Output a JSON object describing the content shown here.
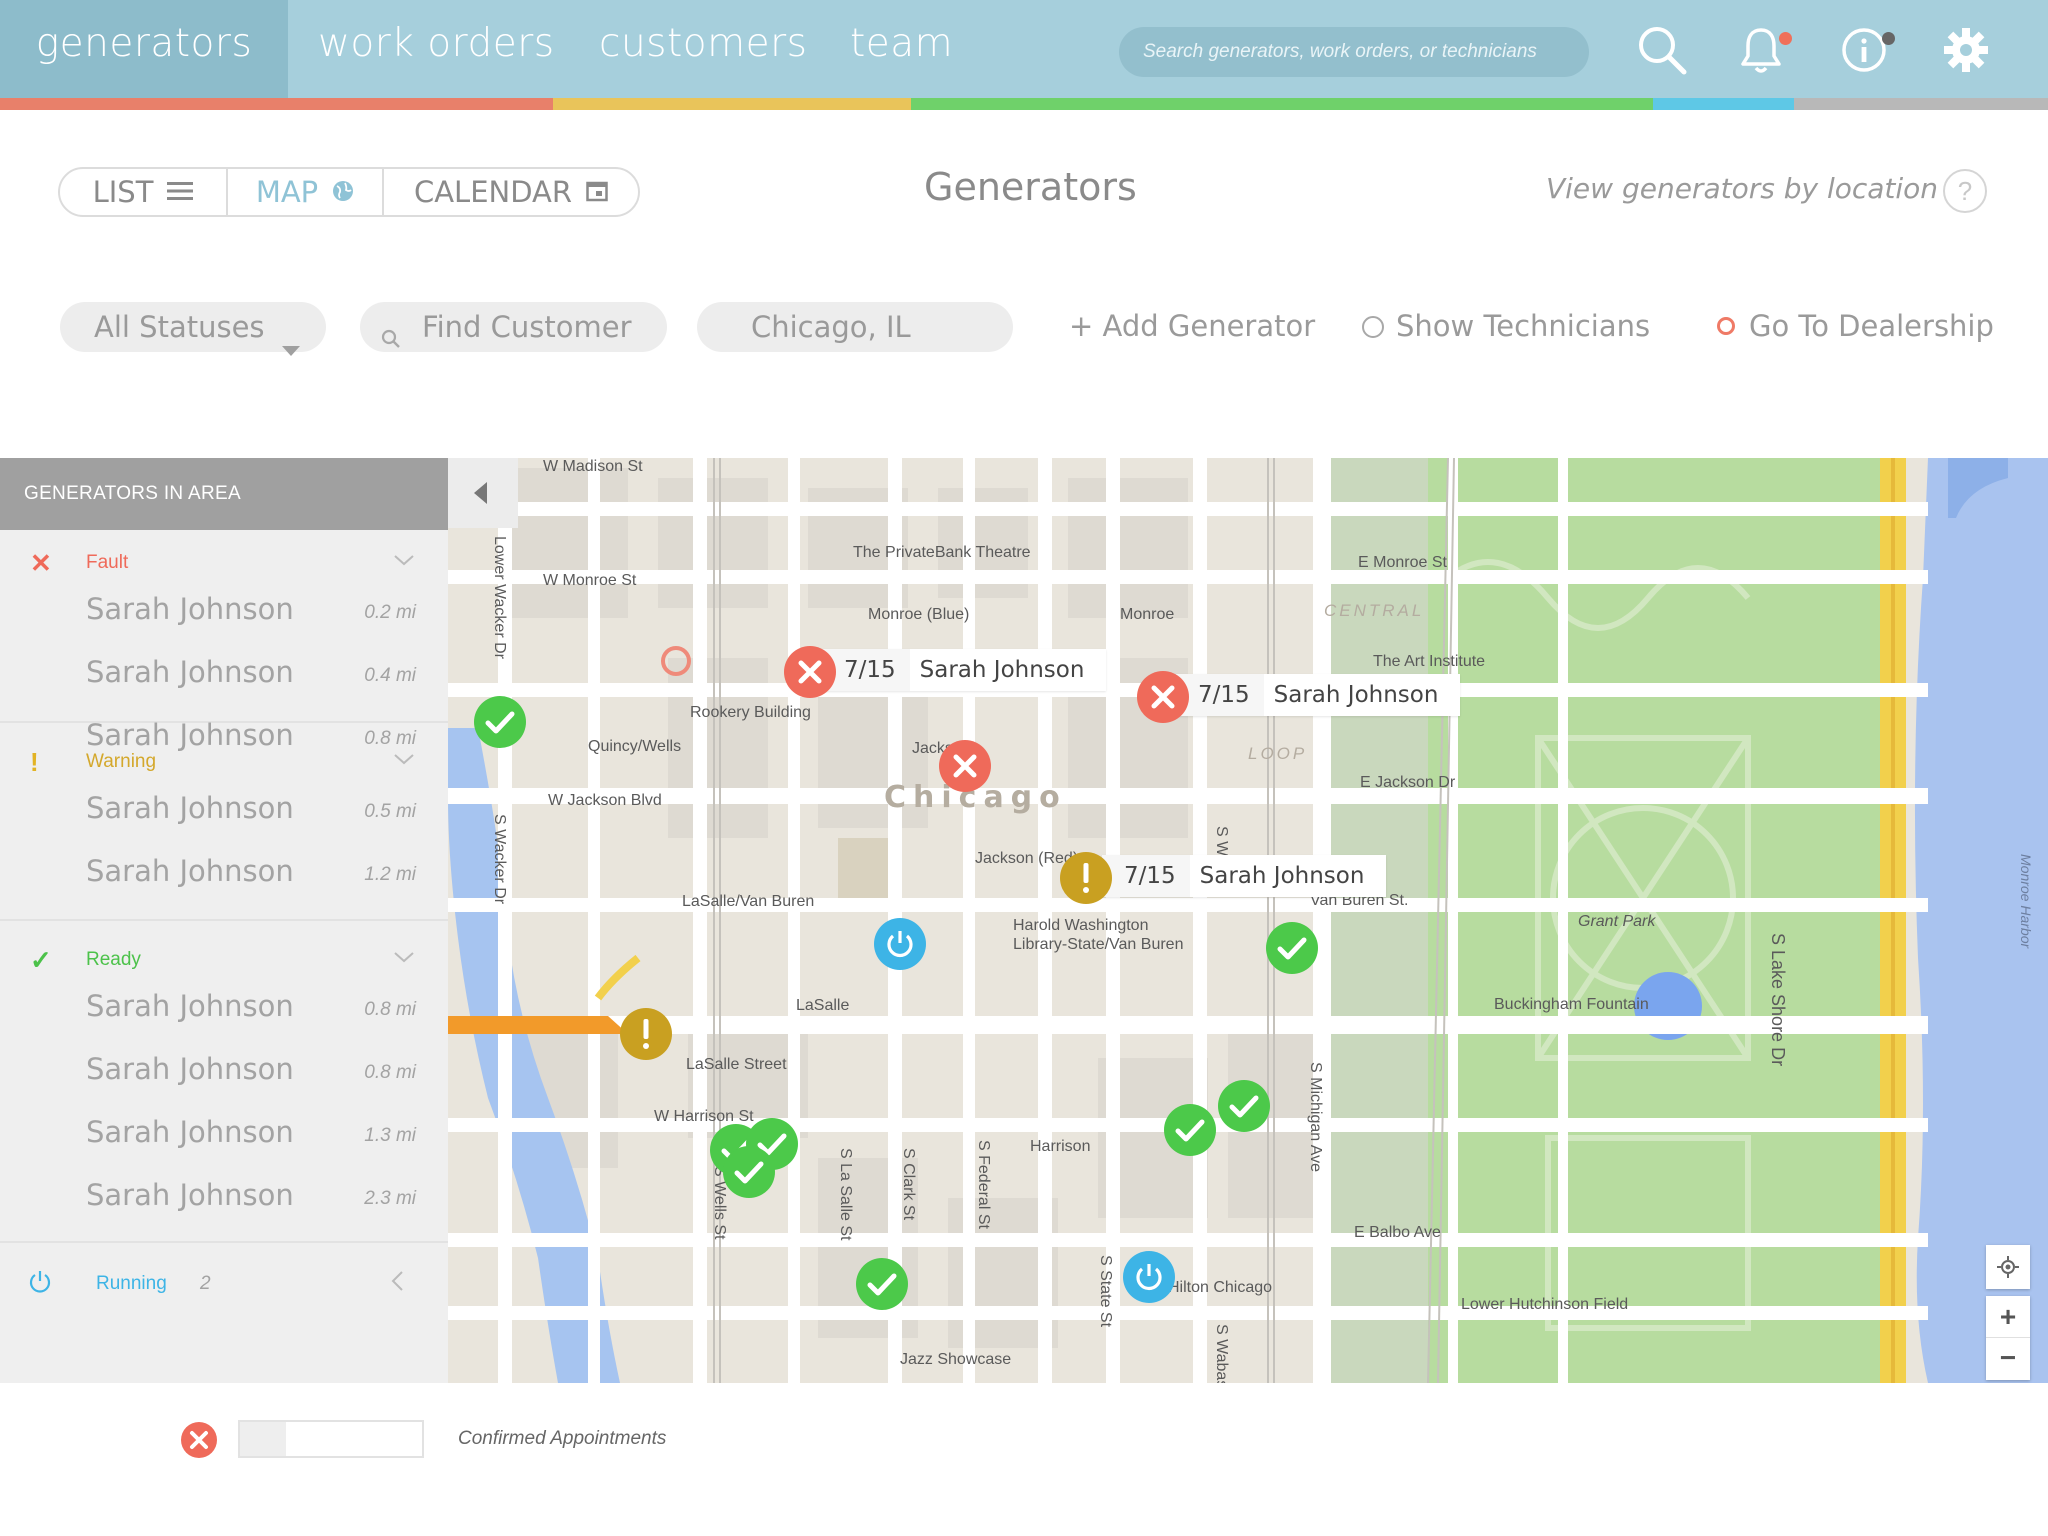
{
  "nav": {
    "tabs": [
      {
        "label": "generators",
        "active": true
      },
      {
        "label": "work orders"
      },
      {
        "label": "customers"
      },
      {
        "label": "team"
      }
    ],
    "search_placeholder": "Search generators, work orders, or technicians",
    "icons": [
      "search-icon",
      "bell-icon",
      "info-icon",
      "gear-icon"
    ],
    "notification_dot_color": "#f0705a",
    "info_dot_color": "#666666",
    "colorbar": [
      "#e8806a",
      "#e9c45a",
      "#6fd16a",
      "#5ec8e6",
      "#b8b8b8"
    ]
  },
  "view_switch": {
    "list_label": "LIST",
    "map_label": "MAP",
    "calendar_label": "CALENDAR",
    "active": "MAP"
  },
  "header": {
    "title": "Generators",
    "subtitle": "View generators by location",
    "help": "?"
  },
  "filters": {
    "status": "All Statuses",
    "customer_placeholder": "Find Customer",
    "location": "Chicago, IL",
    "add_generator": "+ Add Generator",
    "show_technicians": "Show Technicians",
    "go_to_dealership": "Go To Dealership"
  },
  "sidebar": {
    "header": "GENERATORS IN AREA",
    "groups": [
      {
        "label": "Fault",
        "icon": "x-icon",
        "color": "#ef6a5a",
        "items": [
          {
            "name": "Sarah Johnson",
            "distance": "0.2 mi"
          },
          {
            "name": "Sarah Johnson",
            "distance": "0.4 mi"
          },
          {
            "name": "Sarah Johnson",
            "distance": "0.8 mi"
          }
        ]
      },
      {
        "label": "Warning",
        "icon": "exclamation-icon",
        "color": "#d4a82c",
        "items": [
          {
            "name": "Sarah Johnson",
            "distance": "0.5 mi"
          },
          {
            "name": "Sarah Johnson",
            "distance": "1.2 mi"
          }
        ]
      },
      {
        "label": "Ready",
        "icon": "check-icon",
        "color": "#4cc24a",
        "items": [
          {
            "name": "Sarah Johnson",
            "distance": "0.8 mi"
          },
          {
            "name": "Sarah Johnson",
            "distance": "0.8 mi"
          },
          {
            "name": "Sarah Johnson",
            "distance": "1.3 mi"
          },
          {
            "name": "Sarah Johnson",
            "distance": "2.3 mi"
          }
        ]
      }
    ],
    "running": {
      "label": "Running",
      "count": "2",
      "color": "#3db4e6"
    }
  },
  "map": {
    "city_label": "Chicago",
    "district_labels": [
      "CENTRAL",
      "LOOP"
    ],
    "labels": [
      "W Madison St",
      "W Monroe St",
      "E Monroe St",
      "The PrivateBank Theatre",
      "Monroe (Blue)",
      "Monroe",
      "The Art Institute",
      "Rookery Building",
      "Quincy/Wells",
      "Jackson",
      "W Jackson Blvd",
      "E Jackson Dr",
      "Jackson (Red)",
      "LaSalle/Van Buren",
      "Harold Washington",
      "Library-State/Van Buren",
      "Van Buren St.",
      "Grant Park",
      "LaSalle",
      "Buckingham Fountain",
      "LaSalle Street",
      "W Harrison St",
      "Harrison",
      "E Balbo Ave",
      "Hilton Chicago",
      "Lower Hutchinson Field",
      "Jazz Showcase",
      "Lower Wacker Dr",
      "S Wacker Dr",
      "S Wells St",
      "S La Salle St",
      "S Clark St",
      "S Federal St",
      "S State St",
      "S Wabash",
      "S Michigan Ave",
      "S Lake Shore Dr",
      "Monroe Harbor",
      "S Wa"
    ],
    "callouts": [
      {
        "date": "7/15",
        "name": "Sarah Johnson"
      },
      {
        "date": "7/15",
        "name": "Sarah Johnson"
      },
      {
        "date": "7/15",
        "name": "Sarah Johnson"
      }
    ],
    "status_colors": {
      "fault": "#ef6a5a",
      "warning": "#c9a021",
      "ready": "#4cc94a",
      "running": "#3db4e6"
    },
    "zoom_in": "+",
    "zoom_out": "−"
  },
  "legend": {
    "label": "Confirmed Appointments",
    "icon": "x-icon"
  }
}
